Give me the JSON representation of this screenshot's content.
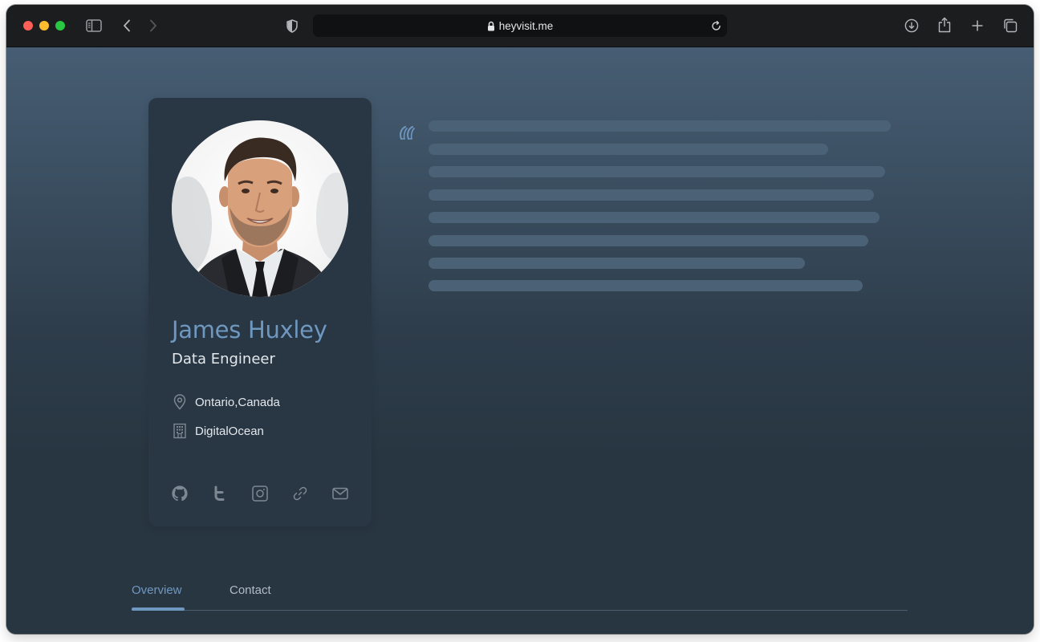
{
  "browser": {
    "url": "heyvisit.me",
    "traffic_lights": [
      "#fe5f57",
      "#febc2e",
      "#28c840"
    ]
  },
  "profile": {
    "name": "James Huxley",
    "role": "Data Engineer",
    "location": "Ontario,Canada",
    "company": "DigitalOcean",
    "social_icons": [
      "github-icon",
      "twitter-icon",
      "instagram-icon",
      "link-icon",
      "mail-icon"
    ]
  },
  "tabs": [
    {
      "label": "Overview",
      "active": true
    },
    {
      "label": "Contact",
      "active": false
    }
  ],
  "colors": {
    "accent": "#6e98c0",
    "page_background": "#283642",
    "card_background": "#293643",
    "skeleton": "#4b6176",
    "muted_icon": "#7e8893"
  }
}
